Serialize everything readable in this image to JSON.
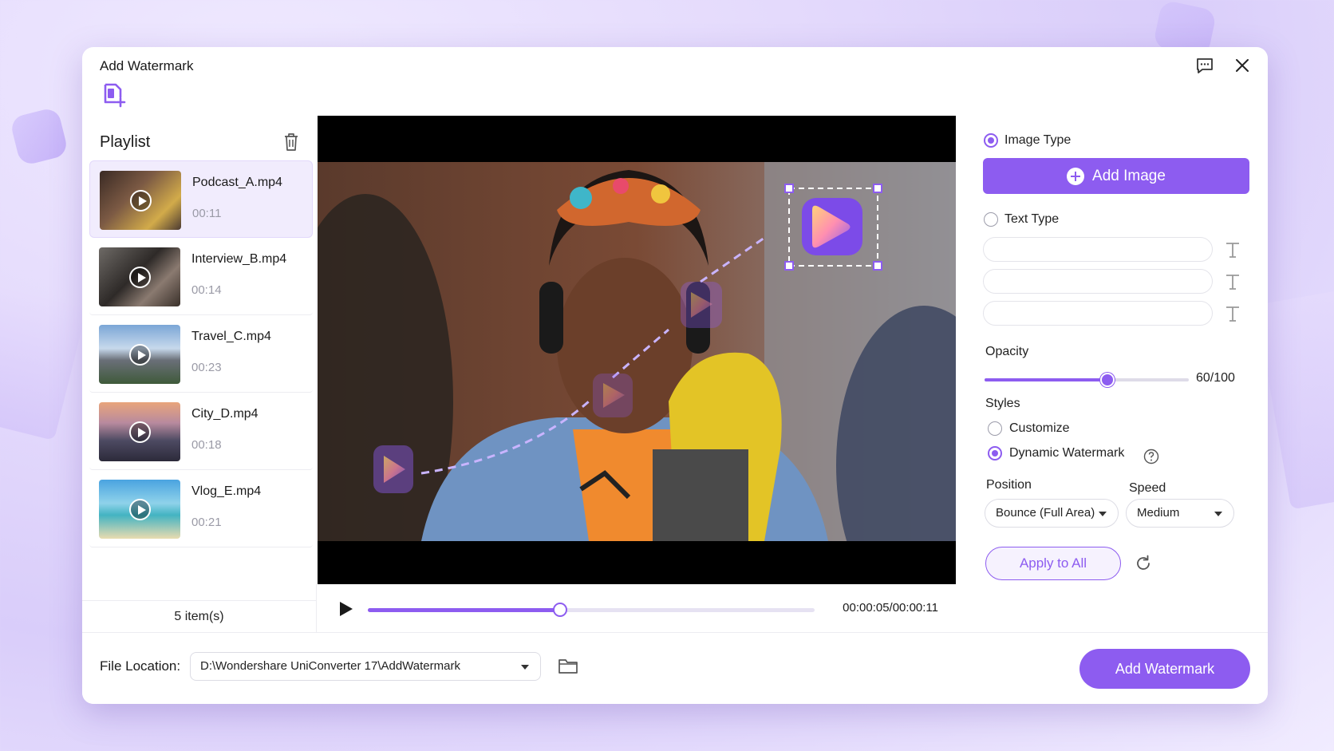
{
  "window": {
    "title": "Add Watermark"
  },
  "playlist": {
    "title": "Playlist",
    "items": [
      {
        "name": "Podcast_A.mp4",
        "duration": "00:11",
        "active": true
      },
      {
        "name": "Interview_B.mp4",
        "duration": "00:14",
        "active": false
      },
      {
        "name": "Travel_C.mp4",
        "duration": "00:23",
        "active": false
      },
      {
        "name": "City_D.mp4",
        "duration": "00:18",
        "active": false
      },
      {
        "name": "Vlog_E.mp4",
        "duration": "00:21",
        "active": false
      }
    ],
    "count": "5 item(s)"
  },
  "player": {
    "time": "00:00:05/00:00:11",
    "progress": 0.43
  },
  "settings": {
    "image_type_label": "Image Type",
    "add_image_label": "Add Image",
    "text_type_label": "Text Type",
    "text_fields": [
      "",
      "",
      ""
    ],
    "opacity_label": "Opacity",
    "opacity_value": "60/100",
    "opacity": 0.6,
    "styles_label": "Styles",
    "customize_label": "Customize",
    "dynamic_label": "Dynamic Watermark",
    "position_label": "Position",
    "position_value": "Bounce (Full Area)",
    "speed_label": "Speed",
    "speed_value": "Medium",
    "apply_all_label": "Apply to All"
  },
  "bottom": {
    "file_location_label": "File Location:",
    "file_location_value": "D:\\Wondershare UniConverter 17\\AddWatermark",
    "add_watermark_label": "Add Watermark"
  },
  "colors": {
    "accent": "#8d5cf0"
  },
  "icons": [
    "add-file-icon",
    "feedback-icon",
    "close-icon",
    "trash-icon",
    "play-icon",
    "text-style-icon",
    "help-icon",
    "reset-icon",
    "folder-icon"
  ]
}
